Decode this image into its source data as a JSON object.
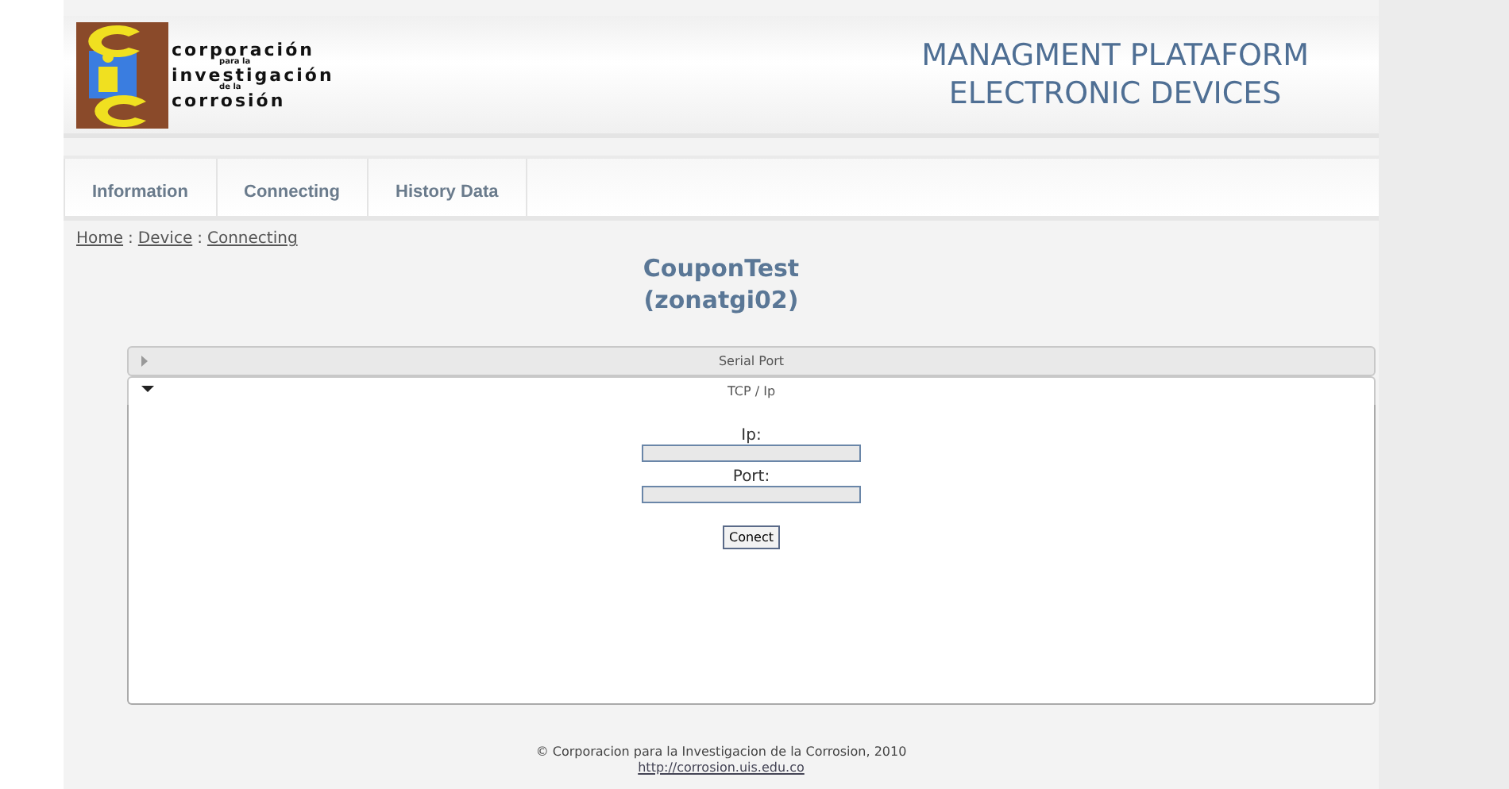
{
  "header": {
    "logo_lines": [
      "corporación",
      "para la",
      "investigación",
      "de la",
      "corrosión"
    ],
    "title_lines": [
      "MANAGMENT PLATAFORM",
      "ELECTRONIC DEVICES"
    ]
  },
  "nav": [
    {
      "label": "Information"
    },
    {
      "label": "Connecting"
    },
    {
      "label": "History Data"
    }
  ],
  "breadcrumb": [
    "Home",
    "Device",
    "Connecting"
  ],
  "breadcrumb_separator": ":",
  "device": {
    "name": "CouponTest",
    "id": "(zonatgi02)"
  },
  "accordion": [
    {
      "title": "Serial Port",
      "expanded": false
    },
    {
      "title": "TCP / Ip",
      "expanded": true,
      "fields": [
        {
          "label": "Ip:"
        },
        {
          "label": "Port:"
        }
      ],
      "button": "Conect"
    }
  ],
  "footer": {
    "copyright": "© Corporacion para la Investigacion de la Corrosion, 2010",
    "link": "http://corrosion.uis.edu.co"
  }
}
